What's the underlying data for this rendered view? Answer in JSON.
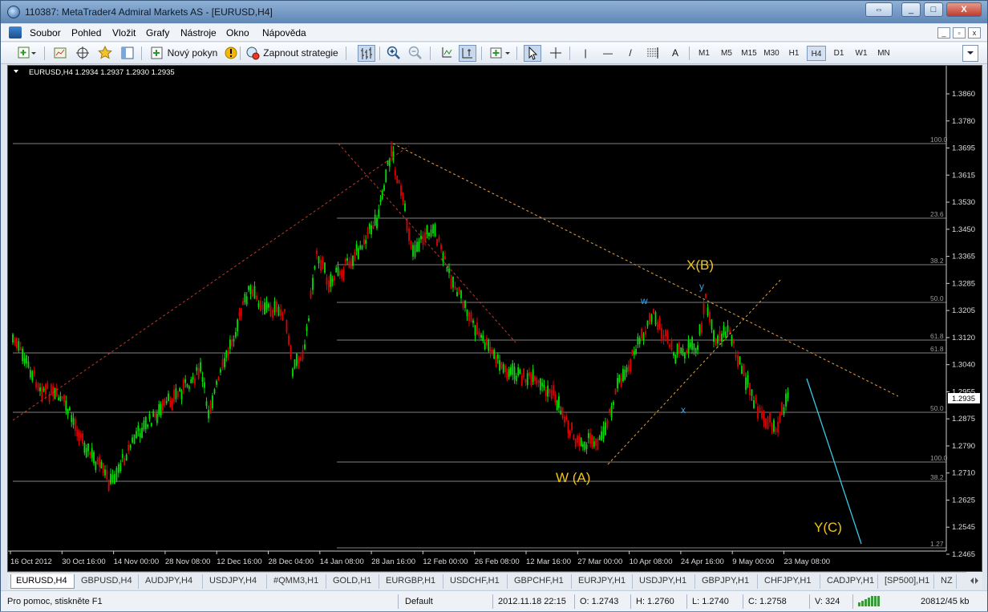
{
  "window": {
    "title": "110387: MetaTrader4 Admiral Markets AS - [EURUSD,H4]",
    "btn_restore": "⇔",
    "btn_min": "_",
    "btn_max": "□",
    "btn_close": "X"
  },
  "menu": {
    "items": [
      "Soubor",
      "Pohled",
      "Vložit",
      "Grafy",
      "Nástroje",
      "Okno",
      "Nápověda"
    ],
    "mdi_min": "_",
    "mdi_restore": "▫",
    "mdi_close": "x"
  },
  "toolbar": {
    "new_order": "Nový pokyn",
    "expert_advisors": "Zapnout strategie",
    "timeframes": [
      "M1",
      "M5",
      "M15",
      "M30",
      "H1",
      "H4",
      "D1",
      "W1",
      "MN"
    ],
    "active_timeframe": "H4",
    "line_tool_labels": [
      "|",
      "—",
      "/",
      "A"
    ]
  },
  "chart": {
    "header": "EURUSD,H4  1.2934  1.2937  1.2930  1.2935",
    "current_price": "1.2935",
    "price_axis": [
      "1.3860",
      "1.3780",
      "1.3695",
      "1.3615",
      "1.3530",
      "1.3450",
      "1.3365",
      "1.3285",
      "1.3205",
      "1.3120",
      "1.3040",
      "1.2955",
      "1.2875",
      "1.2790",
      "1.2710",
      "1.2625",
      "1.2545",
      "1.2465"
    ],
    "time_axis": [
      "16 Oct 2012",
      "30 Oct 16:00",
      "14 Nov 00:00",
      "28 Nov 08:00",
      "12 Dec 16:00",
      "28 Dec 04:00",
      "14 Jan 08:00",
      "28 Jan 16:00",
      "12 Feb 00:00",
      "26 Feb 08:00",
      "12 Mar 16:00",
      "27 Mar 00:00",
      "10 Apr 08:00",
      "24 Apr 16:00",
      "9 May 00:00",
      "23 May 08:00"
    ],
    "fib_levels": [
      "100.0",
      "23.6",
      "38.2",
      "50.0",
      "61.8",
      "61.8",
      "50.0",
      "100.0",
      "38.2",
      "1.27"
    ],
    "annotations": {
      "wa": "W (A)",
      "xb": "X(B)",
      "yc": "Y(C)",
      "w": "w",
      "x": "x",
      "y": "y"
    },
    "colors": {
      "background": "#000000",
      "bull": "#00e000",
      "bear": "#e00000",
      "grid": "#808080",
      "trendline_red": "#c0392b",
      "trendline_orange": "#e8a13a",
      "label_yellow": "#f0c419",
      "label_blue": "#3aa0e8",
      "projection": "#3cc8e8"
    }
  },
  "tabs": {
    "items": [
      "EURUSD,H4",
      "GBPUSD,H4",
      "AUDJPY,H4",
      "USDJPY,H4",
      "#QMM3,H1",
      "GOLD,H1",
      "EURGBP,H1",
      "USDCHF,H1",
      "GBPCHF,H1",
      "EURJPY,H1",
      "USDJPY,H1",
      "GBPJPY,H1",
      "CHFJPY,H1",
      "CADJPY,H1",
      "[SP500],H1",
      "NZ"
    ],
    "active": "EURUSD,H4"
  },
  "status": {
    "help": "Pro pomoc, stiskněte F1",
    "profile": "Default",
    "datetime": "2012.11.18 22:15",
    "open": "O: 1.2743",
    "high": "H: 1.2760",
    "low": "L: 1.2740",
    "close": "C: 1.2758",
    "volume": "V: 324",
    "traffic": "20812/45 kb"
  }
}
